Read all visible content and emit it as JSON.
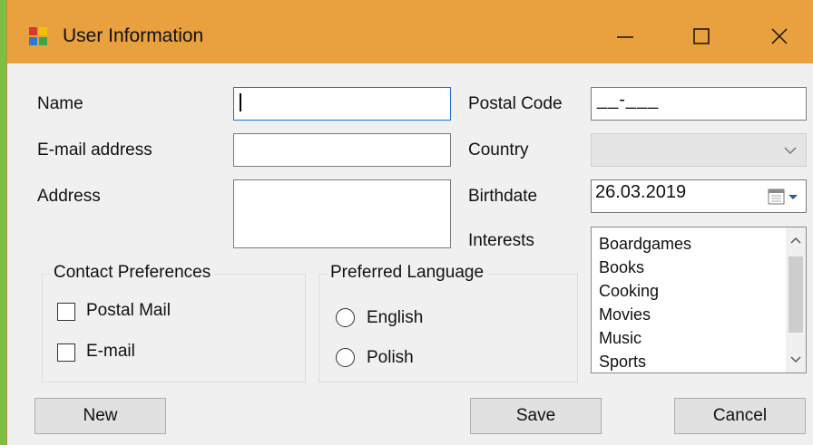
{
  "window": {
    "title": "User Information",
    "icon": "form-window-icon",
    "controls": [
      "minimize-icon",
      "maximize-icon",
      "close-icon"
    ]
  },
  "form": {
    "name": {
      "label": "Name",
      "value": ""
    },
    "email": {
      "label": "E-mail address",
      "value": ""
    },
    "address": {
      "label": "Address",
      "value": ""
    },
    "postal_code": {
      "label": "Postal Code",
      "mask": "__-___"
    },
    "country": {
      "label": "Country",
      "value": ""
    },
    "birthdate": {
      "label": "Birthdate",
      "value": "26.03.2019"
    },
    "interests": {
      "label": "Interests",
      "items": [
        "Boardgames",
        "Books",
        "Cooking",
        "Movies",
        "Music",
        "Sports"
      ]
    }
  },
  "contact_preferences": {
    "legend": "Contact Preferences",
    "options": [
      {
        "label": "Postal Mail",
        "checked": false
      },
      {
        "label": "E-mail",
        "checked": false
      }
    ]
  },
  "preferred_language": {
    "legend": "Preferred Language",
    "options": [
      {
        "label": "English",
        "selected": false
      },
      {
        "label": "Polish",
        "selected": false
      }
    ]
  },
  "buttons": {
    "new": "New",
    "save": "Save",
    "cancel": "Cancel"
  },
  "colors": {
    "titlebar": "#e9a03f",
    "background": "#f0f0f0",
    "focus_border": "#1e6fd1"
  }
}
